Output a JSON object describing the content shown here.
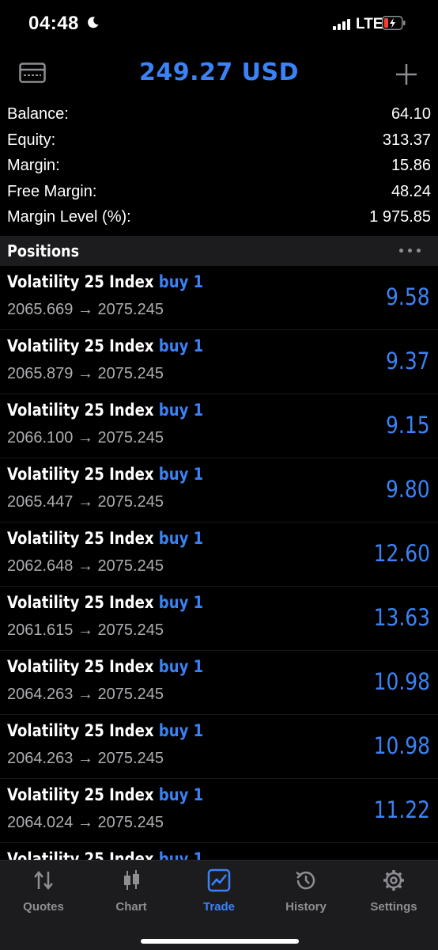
{
  "status_bar": {
    "time": "04:48",
    "network": "LTE"
  },
  "header": {
    "title": "249.27 USD"
  },
  "summary": [
    {
      "label": "Balance:",
      "value": "64.10"
    },
    {
      "label": "Equity:",
      "value": "313.37"
    },
    {
      "label": "Margin:",
      "value": "15.86"
    },
    {
      "label": "Free Margin:",
      "value": "48.24"
    },
    {
      "label": "Margin Level (%):",
      "value": "1 975.85"
    }
  ],
  "positions_section": {
    "title": "Positions"
  },
  "positions": [
    {
      "symbol": "Volatility 25 Index",
      "side": "buy 1",
      "prices": "2065.669 → 2075.245",
      "profit": "9.58"
    },
    {
      "symbol": "Volatility 25 Index",
      "side": "buy 1",
      "prices": "2065.879 → 2075.245",
      "profit": "9.37"
    },
    {
      "symbol": "Volatility 25 Index",
      "side": "buy 1",
      "prices": "2066.100 → 2075.245",
      "profit": "9.15"
    },
    {
      "symbol": "Volatility 25 Index",
      "side": "buy 1",
      "prices": "2065.447 → 2075.245",
      "profit": "9.80"
    },
    {
      "symbol": "Volatility 25 Index",
      "side": "buy 1",
      "prices": "2062.648 → 2075.245",
      "profit": "12.60"
    },
    {
      "symbol": "Volatility 25 Index",
      "side": "buy 1",
      "prices": "2061.615 → 2075.245",
      "profit": "13.63"
    },
    {
      "symbol": "Volatility 25 Index",
      "side": "buy 1",
      "prices": "2064.263 → 2075.245",
      "profit": "10.98"
    },
    {
      "symbol": "Volatility 25 Index",
      "side": "buy 1",
      "prices": "2064.263 → 2075.245",
      "profit": "10.98"
    },
    {
      "symbol": "Volatility 25 Index",
      "side": "buy 1",
      "prices": "2064.024 → 2075.245",
      "profit": "11.22"
    },
    {
      "symbol": "Volatility 25 Index",
      "side": "buy 1",
      "prices": "",
      "profit": ""
    }
  ],
  "tabs": [
    {
      "label": "Quotes",
      "icon": "quotes-icon",
      "active": false
    },
    {
      "label": "Chart",
      "icon": "chart-icon",
      "active": false
    },
    {
      "label": "Trade",
      "icon": "trade-icon",
      "active": true
    },
    {
      "label": "History",
      "icon": "history-icon",
      "active": false
    },
    {
      "label": "Settings",
      "icon": "settings-icon",
      "active": false
    }
  ],
  "colors": {
    "accent": "#3b82f6",
    "background": "#000000",
    "bar": "#1c1c1e"
  }
}
